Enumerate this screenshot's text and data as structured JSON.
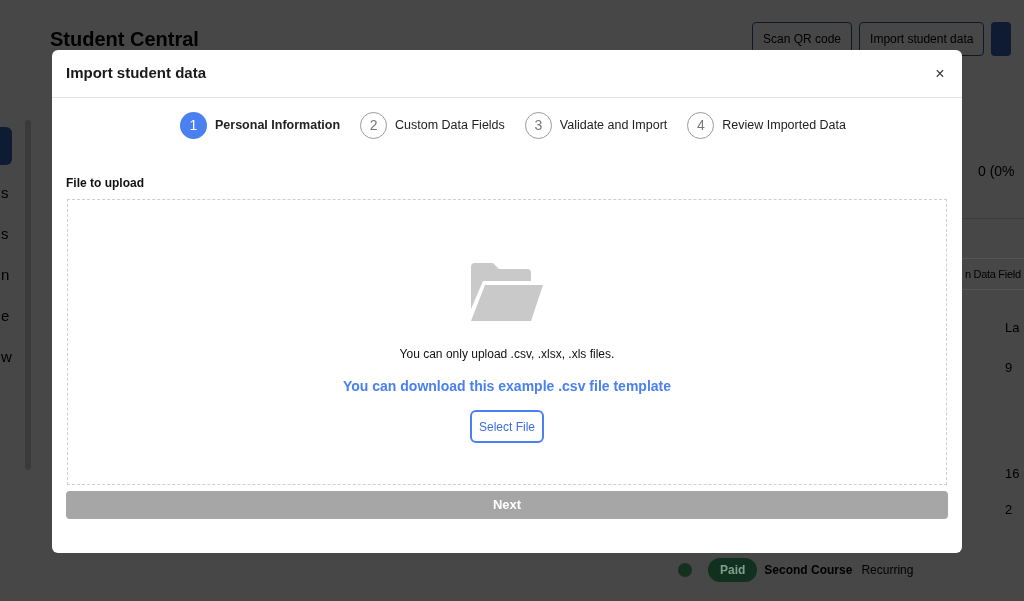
{
  "page": {
    "title": "Student Central",
    "header_buttons": [
      {
        "label": "Scan QR code"
      },
      {
        "label": "Import student data"
      }
    ],
    "sidebar_fragments": [
      {
        "selected": true
      },
      {
        "text": "s",
        "selected": false
      },
      {
        "text": "s",
        "selected": false
      },
      {
        "text": "n",
        "selected": false
      },
      {
        "text": "e",
        "selected": false
      },
      {
        "text": "w",
        "selected": false
      }
    ],
    "summary_value": "0 (0%",
    "fields_button": "n Data Field",
    "table": {
      "column_header": "La",
      "cells": [
        "9",
        "16",
        "2"
      ]
    },
    "payment_row": {
      "status": "Paid",
      "course": "Second Course",
      "type": "Recurring"
    }
  },
  "dialog": {
    "title": "Import student data",
    "close": "×",
    "steps": [
      {
        "number": "1",
        "label": "Personal Information",
        "selected": true
      },
      {
        "number": "2",
        "label": "Custom Data Fields",
        "selected": false
      },
      {
        "number": "3",
        "label": "Validate and Import",
        "selected": false
      },
      {
        "number": "4",
        "label": "Review Imported Data",
        "selected": false
      }
    ],
    "upload": {
      "label": "File to upload",
      "hint": "You can only upload .csv, .xlsx, .xls files.",
      "template_link": "You can download this example .csv file template",
      "select_button": "Select File"
    },
    "next_button": {
      "label": "Next",
      "disabled": true
    }
  }
}
